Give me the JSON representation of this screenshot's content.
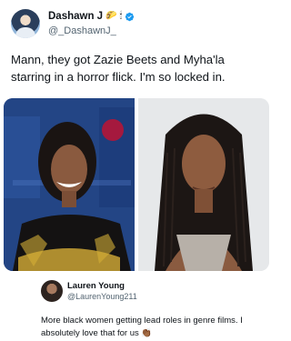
{
  "tweet": {
    "author": {
      "display_name": "Dashawn J",
      "name_emojis": [
        "🌮",
        "🕯"
      ],
      "handle": "@_DashawnJ_",
      "verified": true,
      "avatar_icon": "profile-avatar"
    },
    "text": "Mann, they got Zazie Beets and Myha'la starring in a horror flick. I'm so locked in.",
    "media": [
      {
        "name": "photo-woman-smiling-blue-backdrop"
      },
      {
        "name": "photo-woman-braids-portrait"
      }
    ]
  },
  "quoted_tweet": {
    "display_name": "Lauren Young",
    "handle": "@LaurenYoung211",
    "text": "More black women getting lead roles in genre films. I absolutely love that for us",
    "trailing_emoji": "👏🏾"
  },
  "colors": {
    "text_primary": "#0f1419",
    "text_secondary": "#536471",
    "verified_blue": "#1d9bf0"
  }
}
